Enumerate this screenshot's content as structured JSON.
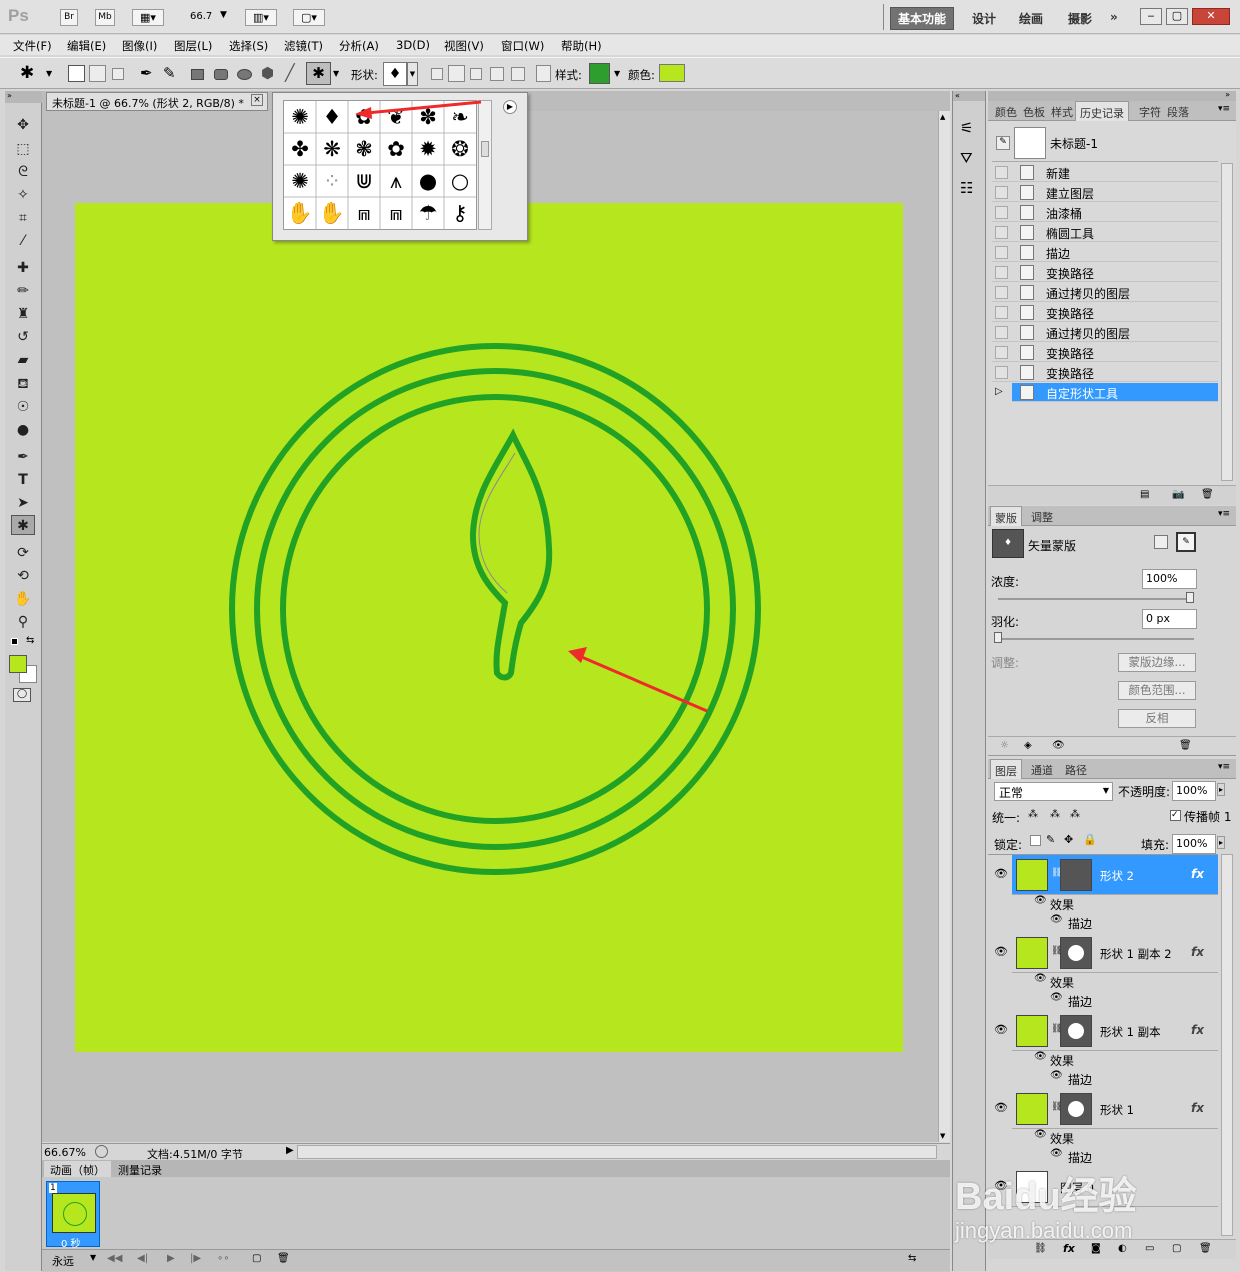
{
  "app": {
    "logo": "Ps",
    "br": "Br",
    "mb": "Mb",
    "zoom": "66.7"
  },
  "workspaces": [
    "基本功能",
    "设计",
    "绘画",
    "摄影",
    "»"
  ],
  "menu": [
    "文件(F)",
    "编辑(E)",
    "图像(I)",
    "图层(L)",
    "选择(S)",
    "滤镜(T)",
    "分析(A)",
    "3D(D)",
    "视图(V)",
    "窗口(W)",
    "帮助(H)"
  ],
  "options": {
    "shape_label": "形状:",
    "style_label": "样式:",
    "color_label": "颜色:",
    "style_color": "#2e9f2e",
    "fill_color": "#b6e61e"
  },
  "document": {
    "tab_title": "未标题-1 @ 66.7% (形状 2, RGB/8) *",
    "close": "×",
    "canvas_color": "#b6e61e",
    "stroke_color": "#21a224"
  },
  "status": {
    "zoom": "66.67%",
    "doc_size": "文档:4.51M/0 字节"
  },
  "anim": {
    "tab1": "动画（帧）",
    "tab2": "测量记录",
    "frame_num": "1",
    "frame_time": "0 秒",
    "loop": "永远"
  },
  "history": {
    "tabs": [
      "颜色",
      "色板",
      "样式",
      "历史记录",
      "字符",
      "段落"
    ],
    "snapshot": "未标题-1",
    "items": [
      "新建",
      "建立图层",
      "油漆桶",
      "椭圆工具",
      "描边",
      "变换路径",
      "通过拷贝的图层",
      "变换路径",
      "通过拷贝的图层",
      "变换路径",
      "变换路径",
      "自定形状工具"
    ]
  },
  "masks": {
    "tabs": [
      "蒙版",
      "调整"
    ],
    "title": "矢量蒙版",
    "density_label": "浓度:",
    "density": "100%",
    "feather_label": "羽化:",
    "feather": "0 px",
    "adjust_label": "调整:",
    "btn_edge": "蒙版边缘...",
    "btn_range": "颜色范围...",
    "btn_invert": "反相"
  },
  "layers": {
    "tabs": [
      "图层",
      "通道",
      "路径"
    ],
    "blend": "正常",
    "opacity_label": "不透明度:",
    "opacity": "100%",
    "unify_label": "统一:",
    "propagate": "传播帧 1",
    "lock_label": "锁定:",
    "fill_label": "填充:",
    "fill": "100%",
    "effect_label": "效果",
    "stroke_label": "描边",
    "items": [
      {
        "name": "形状 2"
      },
      {
        "name": "形状 1 副本 2"
      },
      {
        "name": "形状 1 副本"
      },
      {
        "name": "形状 1"
      },
      {
        "name": "图层 0"
      }
    ],
    "fx": "fx"
  },
  "watermark": {
    "line1": "Baidu经验",
    "line2": "jingyan.baidu.com"
  }
}
